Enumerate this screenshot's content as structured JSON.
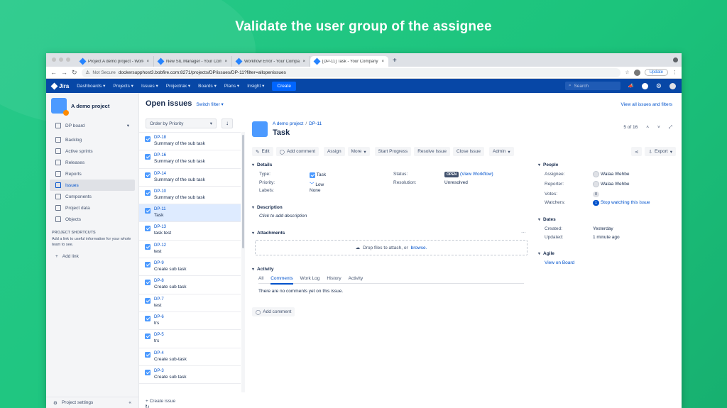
{
  "headline": "Validate the user group of the assignee",
  "browser": {
    "tabs": [
      {
        "title": "Project A demo project - Work"
      },
      {
        "title": "New SIL Manager - Your Comp"
      },
      {
        "title": "Workflow Error - Your Compan"
      },
      {
        "title": "[DP-11] Task - Your Company J"
      }
    ],
    "url_prefix": "Not Secure",
    "url": "dockersupphost3.bobfire.com:8271/projects/DP/issues/DP-11?filter=allopenissues",
    "update": "Update"
  },
  "jira_nav": {
    "logo": "Jira",
    "items": [
      "Dashboards",
      "Projects",
      "Issues",
      "Projectrak",
      "Boards",
      "Plans",
      "Insight"
    ],
    "create": "Create",
    "search_placeholder": "Search"
  },
  "sidebar": {
    "project_name": "A demo project",
    "board": "DP board",
    "items": [
      "Backlog",
      "Active sprints",
      "Releases",
      "Reports",
      "Issues",
      "Components",
      "Project data",
      "Objects"
    ],
    "selected_item": "Issues",
    "shortcuts_heading": "PROJECT SHORTCUTS",
    "shortcuts_help": "Add a link to useful information for your whole team to see.",
    "add_link": "Add link",
    "settings": "Project settings"
  },
  "issue_list": {
    "title": "Open issues",
    "switch_filter": "Switch filter",
    "order_by": "Order by Priority",
    "create_issue": "+ Create issue",
    "issues": [
      {
        "key": "DP-18",
        "summary": "Summary of the sub task",
        "type": "subtask"
      },
      {
        "key": "DP-16",
        "summary": "Summary of the sub task",
        "type": "subtask"
      },
      {
        "key": "DP-14",
        "summary": "Summary of the sub task",
        "type": "subtask"
      },
      {
        "key": "DP-10",
        "summary": "Summary of the sub task",
        "type": "subtask"
      },
      {
        "key": "DP-11",
        "summary": "Task",
        "type": "task",
        "selected": true
      },
      {
        "key": "DP-13",
        "summary": "task test",
        "type": "task"
      },
      {
        "key": "DP-12",
        "summary": "test",
        "type": "task"
      },
      {
        "key": "DP-9",
        "summary": "Create sub task",
        "type": "task"
      },
      {
        "key": "DP-8",
        "summary": "Create sub task",
        "type": "task"
      },
      {
        "key": "DP-7",
        "summary": "test",
        "type": "task"
      },
      {
        "key": "DP-6",
        "summary": "trs",
        "type": "task"
      },
      {
        "key": "DP-5",
        "summary": "trs",
        "type": "task"
      },
      {
        "key": "DP-4",
        "summary": "Create sub-task",
        "type": "task"
      },
      {
        "key": "DP-3",
        "summary": "Create sub task",
        "type": "task"
      }
    ]
  },
  "issue": {
    "view_all": "View all issues and filters",
    "breadcrumb_project": "A demo project",
    "breadcrumb_key": "DP-11",
    "title": "Task",
    "pager": "5 of 16",
    "toolbar": [
      "Edit",
      "Add comment",
      "Assign",
      "More",
      "Start Progress",
      "Resolve Issue",
      "Close Issue",
      "Admin"
    ],
    "export": "Export",
    "details_heading": "Details",
    "type_label": "Type:",
    "type_value": "Task",
    "priority_label": "Priority:",
    "priority_value": "Low",
    "labels_label": "Labels:",
    "labels_value": "None",
    "status_label": "Status:",
    "status_value": "OPEN",
    "view_workflow": "(View Workflow)",
    "resolution_label": "Resolution:",
    "resolution_value": "Unresolved",
    "description_heading": "Description",
    "description_placeholder": "Click to add description",
    "attachments_heading": "Attachments",
    "drop_text": "Drop files to attach, or",
    "browse": "browse.",
    "activity_heading": "Activity",
    "activity_tabs": [
      "All",
      "Comments",
      "Work Log",
      "History",
      "Activity"
    ],
    "no_comments": "There are no comments yet on this issue.",
    "add_comment": "Add comment",
    "people_heading": "People",
    "assignee_label": "Assignee:",
    "assignee": "Walaa Wehbe",
    "reporter_label": "Reporter:",
    "reporter": "Walaa Wehbe",
    "votes_label": "Votes:",
    "votes": "0",
    "watchers_label": "Watchers:",
    "watchers_count": "1",
    "watchers_link": "Stop watching this issue",
    "dates_heading": "Dates",
    "created_label": "Created:",
    "created": "Yesterday",
    "updated_label": "Updated:",
    "updated": "1 minute ago",
    "agile_heading": "Agile",
    "view_on_board": "View on Board"
  }
}
